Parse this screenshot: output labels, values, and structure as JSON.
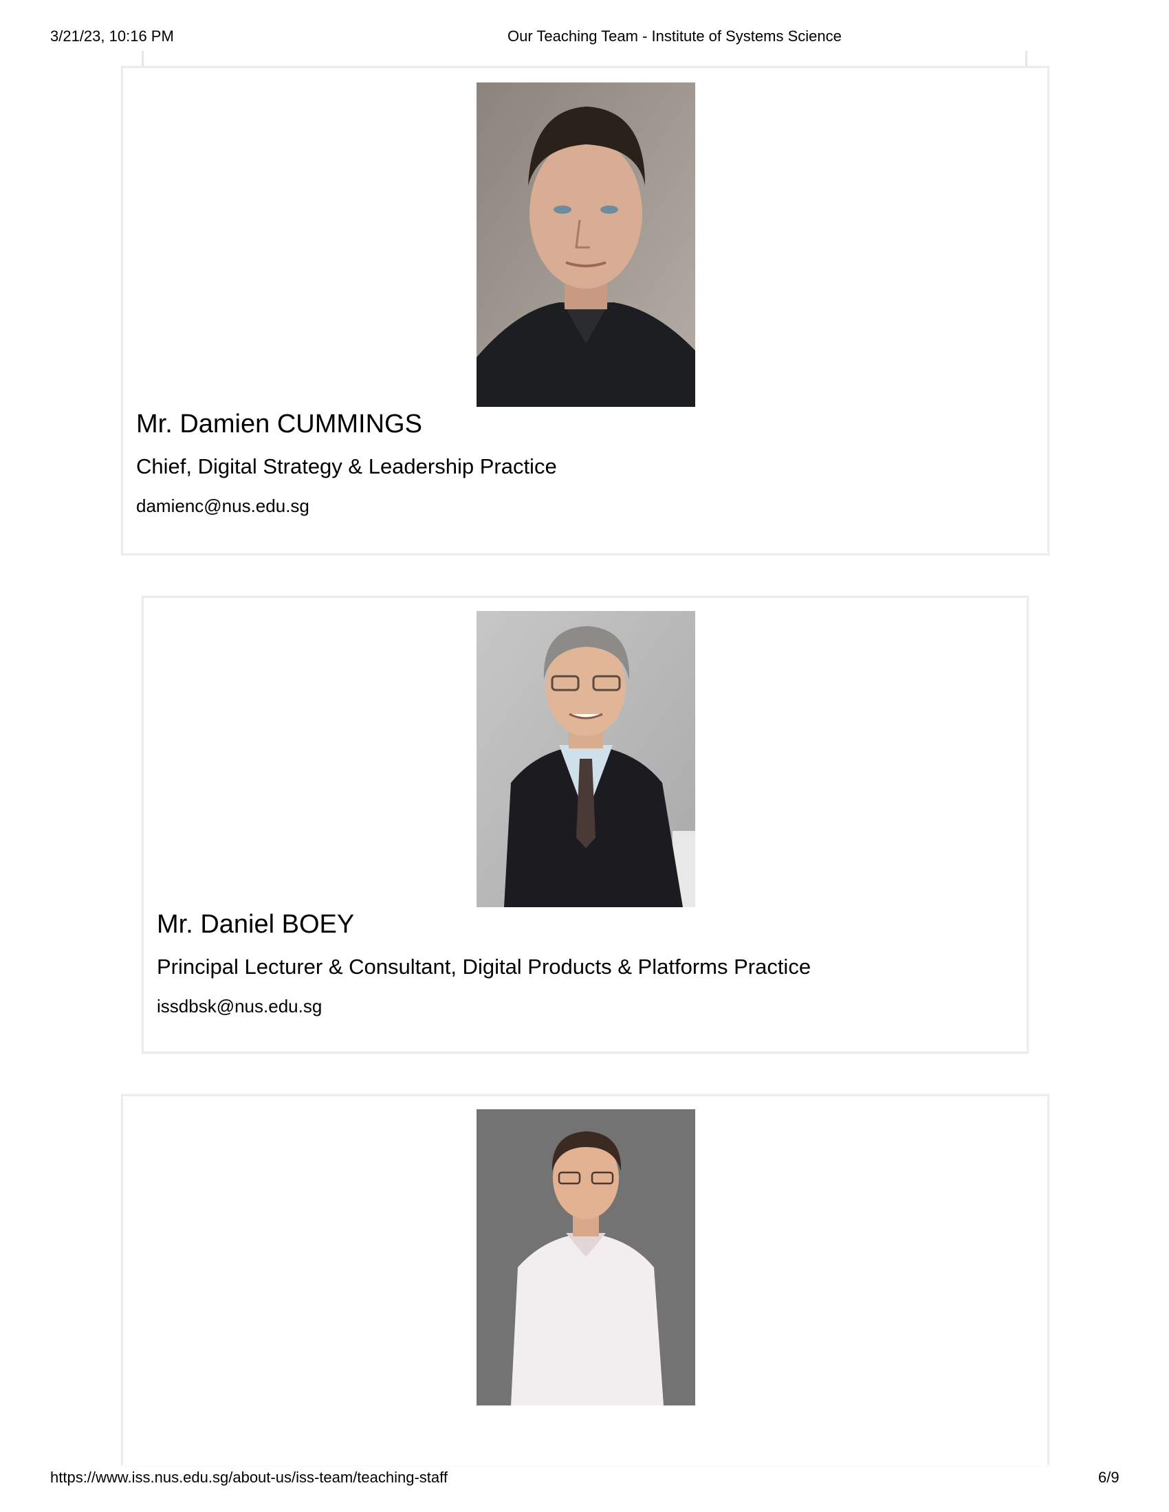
{
  "print_header": {
    "datetime": "3/21/23, 10:16 PM",
    "title": "Our Teaching Team - Institute of Systems Science"
  },
  "print_footer": {
    "url": "https://www.iss.nus.edu.sg/about-us/iss-team/teaching-staff",
    "page": "6/9"
  },
  "staff": [
    {
      "name": "Mr. Damien CUMMINGS",
      "title": "Chief, Digital Strategy & Leadership Practice",
      "email": "damienc@nus.edu.sg"
    },
    {
      "name": "Mr. Daniel BOEY",
      "title": "Principal Lecturer & Consultant, Digital Products & Platforms Practice",
      "email": "issdbsk@nus.edu.sg"
    }
  ]
}
